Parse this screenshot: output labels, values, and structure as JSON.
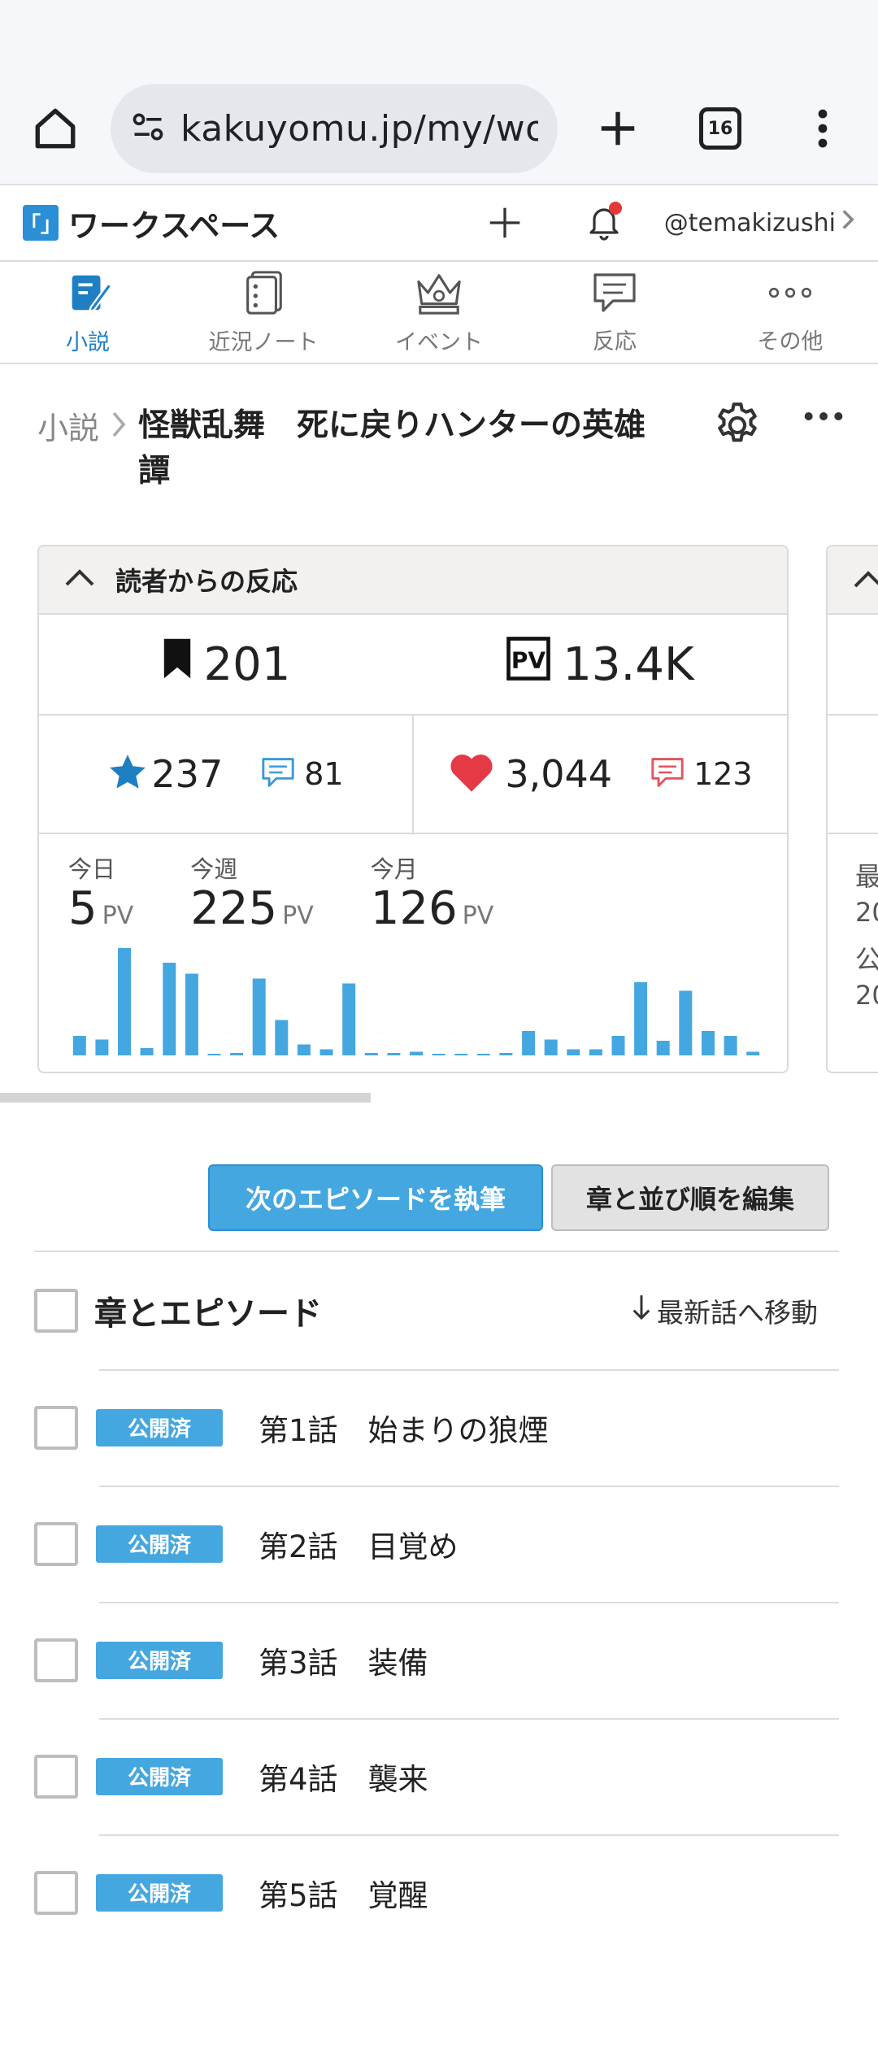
{
  "browser": {
    "url": "kakuyomu.jp/my/worl",
    "tab_count": "16"
  },
  "header": {
    "logo": "「」",
    "title": "ワークスペース",
    "user": "@temakizushi"
  },
  "tabs": [
    {
      "label": "小説",
      "active": true
    },
    {
      "label": "近況ノート"
    },
    {
      "label": "イベント"
    },
    {
      "label": "反応"
    },
    {
      "label": "その他"
    }
  ],
  "breadcrumb": {
    "root": "小説",
    "title": "怪獣乱舞　死に戻りハンターの英雄譚"
  },
  "stats": {
    "heading": "読者からの反応",
    "bookmarks": "201",
    "pv_total": "13.4K",
    "stars": "237",
    "star_reviews": "81",
    "hearts": "3,044",
    "comments": "123",
    "today_label": "今日",
    "today_value": "5",
    "week_label": "今週",
    "week_value": "225",
    "month_label": "今月",
    "month_value": "126",
    "pv_unit": "PV",
    "peek_lines": [
      "最",
      "20",
      "公",
      "20"
    ]
  },
  "chart_data": {
    "type": "bar",
    "values": [
      16,
      13,
      88,
      6,
      76,
      67,
      1,
      2,
      63,
      29,
      9,
      5,
      59,
      2,
      2,
      3,
      1,
      0,
      0,
      2,
      20,
      13,
      5,
      5,
      16,
      60,
      12,
      53,
      20,
      16,
      3
    ],
    "color": "#45a7e0"
  },
  "actions": {
    "write_next": "次のエピソードを執筆",
    "edit_order": "章と並び順を編集"
  },
  "episodes": {
    "heading": "章とエピソード",
    "jump_latest": "最新話へ移動",
    "status_label": "公開済",
    "items": [
      {
        "title": "第1話　始まりの狼煙"
      },
      {
        "title": "第2話　目覚め"
      },
      {
        "title": "第3話　装備"
      },
      {
        "title": "第4話　襲来"
      },
      {
        "title": "第5話　覚醒"
      }
    ]
  }
}
